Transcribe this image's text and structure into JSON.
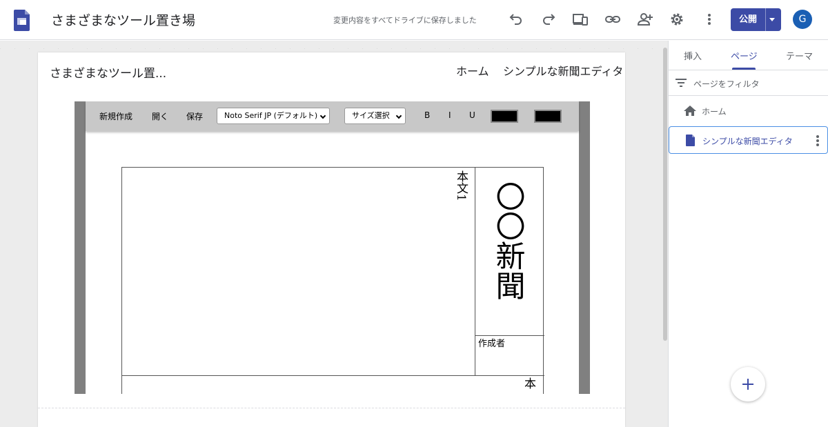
{
  "app": {
    "title": "さまざまなツール置き場",
    "save_status": "変更内容をすべてドライブに保存しました",
    "publish_label": "公開",
    "avatar_letter": "G",
    "accent_color": "#3c4ba6",
    "icons": [
      "sites-logo-icon",
      "undo-icon",
      "redo-icon",
      "preview-devices-icon",
      "link-icon",
      "share-add-person-icon",
      "settings-gear-icon",
      "more-vert-icon"
    ]
  },
  "site": {
    "title": "さまざまなツール置...",
    "nav": [
      "ホーム",
      "シンプルな新聞エディタ"
    ]
  },
  "editor": {
    "buttons": {
      "new": "新規作成",
      "open": "開く",
      "save": "保存",
      "bold": "B",
      "italic": "I",
      "underline": "U"
    },
    "font_select": "Noto Serif JP (デフォルト)",
    "size_select": "サイズ選択",
    "text_color": "#000000",
    "bg_color": "#000000"
  },
  "newspaper": {
    "body1": "本文1",
    "masthead": "〇〇新聞",
    "author_label": "作成者",
    "body2": "本"
  },
  "sidebar": {
    "tabs": [
      "挿入",
      "ページ",
      "テーマ"
    ],
    "active_tab": "ページ",
    "filter_placeholder": "ページをフィルタ",
    "pages": [
      {
        "label": "ホーム",
        "icon": "home-icon"
      },
      {
        "label": "シンプルな新聞エディタ",
        "icon": "page-doc-icon",
        "selected": true
      }
    ]
  }
}
